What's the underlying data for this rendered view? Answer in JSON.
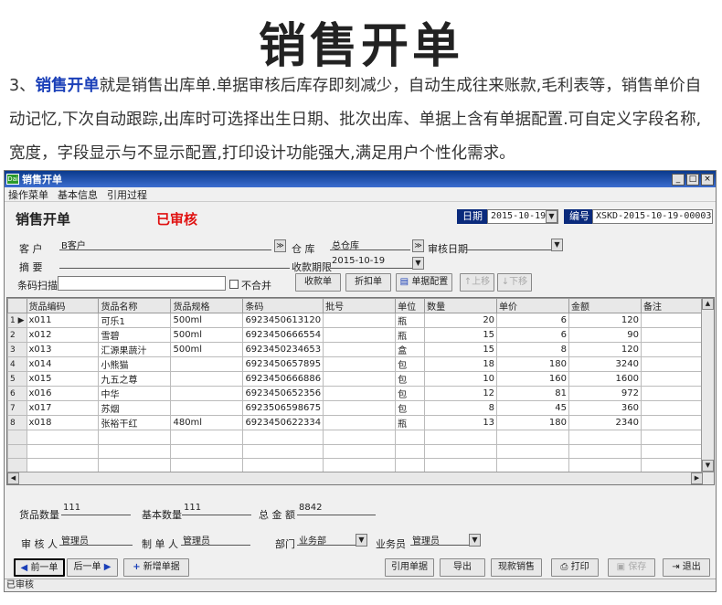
{
  "page": {
    "headline": "销售开单",
    "intro_prefix": "3、",
    "intro_highlight": "销售开单",
    "intro_body": "就是销售出库单.单据审核后库存即刻减少，自动生成往来账款,毛利表等，销售单价自动记忆,下次自动跟踪,出库时可选择出生日期、批次出库、单据上含有单据配置.可自定义字段名称,宽度，字段显示与不显示配置,打印设计功能强大,满足用户个性化需求。"
  },
  "window": {
    "title": "销售开单",
    "app_icon": "Dai",
    "minimize": "_",
    "maximize": "□",
    "close": "×",
    "menu": [
      "操作菜单",
      "基本信息",
      "引用过程"
    ]
  },
  "form": {
    "title": "销售开单",
    "status": "已审核",
    "date_label": "日期",
    "date_value": "2015-10-19",
    "no_label": "编号",
    "no_value": "XSKD-2015-10-19-00003",
    "customer_label": "客    户",
    "customer_value": "B客户",
    "warehouse_label": "仓    库",
    "warehouse_value": "总仓库",
    "audit_date_label": "审核日期",
    "audit_date_value": "",
    "summary_label": "摘    要",
    "summary_value": "",
    "collect_label": "收款期限",
    "collect_value": "2015-10-19",
    "barcode_label": "条码扫描",
    "barcode_value": "",
    "merge_label": "不合并",
    "btn_collect": "收款单",
    "btn_discount": "折扣单",
    "btn_config": "单据配置",
    "btn_up": "↑上移",
    "btn_down": "↓下移"
  },
  "grid": {
    "columns": [
      "货品编码",
      "货品名称",
      "货品规格",
      "条码",
      "批号",
      "单位",
      "数量",
      "单价",
      "金额",
      "备注"
    ],
    "rows": [
      [
        "1",
        "x011",
        "可乐1",
        "500ml",
        "6923450613120",
        "",
        "瓶",
        "20",
        "6",
        "120",
        ""
      ],
      [
        "2",
        "x012",
        "雪碧",
        "500ml",
        "6923450666554",
        "",
        "瓶",
        "15",
        "6",
        "90",
        ""
      ],
      [
        "3",
        "x013",
        "汇源果蔬汁",
        "500ml",
        "6923450234653",
        "",
        "盒",
        "15",
        "8",
        "120",
        ""
      ],
      [
        "4",
        "x014",
        "小熊猫",
        "",
        "6923450657895",
        "",
        "包",
        "18",
        "180",
        "3240",
        ""
      ],
      [
        "5",
        "x015",
        "九五之尊",
        "",
        "6923450666886",
        "",
        "包",
        "10",
        "160",
        "1600",
        ""
      ],
      [
        "6",
        "x016",
        "中华",
        "",
        "6923450652356",
        "",
        "包",
        "12",
        "81",
        "972",
        ""
      ],
      [
        "7",
        "x017",
        "苏烟",
        "",
        "6923506598675",
        "",
        "包",
        "8",
        "45",
        "360",
        ""
      ],
      [
        "8",
        "x018",
        "张裕干红",
        "480ml",
        "6923450622334",
        "",
        "瓶",
        "13",
        "180",
        "2340",
        ""
      ]
    ]
  },
  "footer": {
    "qty_label": "货品数量",
    "qty_value": "111",
    "base_qty_label": "基本数量",
    "base_qty_value": "111",
    "total_label": "总 金 额",
    "total_value": "8842",
    "auditor_label": "审 核 人",
    "auditor_value": "管理员",
    "maker_label": "制 单 人",
    "maker_value": "管理员",
    "dept_label": "部门",
    "dept_value": "业务部",
    "sales_label": "业务员",
    "sales_value": "管理员"
  },
  "buttons": {
    "prev": "前一单",
    "next": "后一单",
    "new": "新增单据",
    "cite": "引用单据",
    "export": "导出",
    "cash_sale": "现款销售",
    "print": "打印",
    "save": "保存",
    "exit": "退出"
  },
  "statusbar": "已审核"
}
